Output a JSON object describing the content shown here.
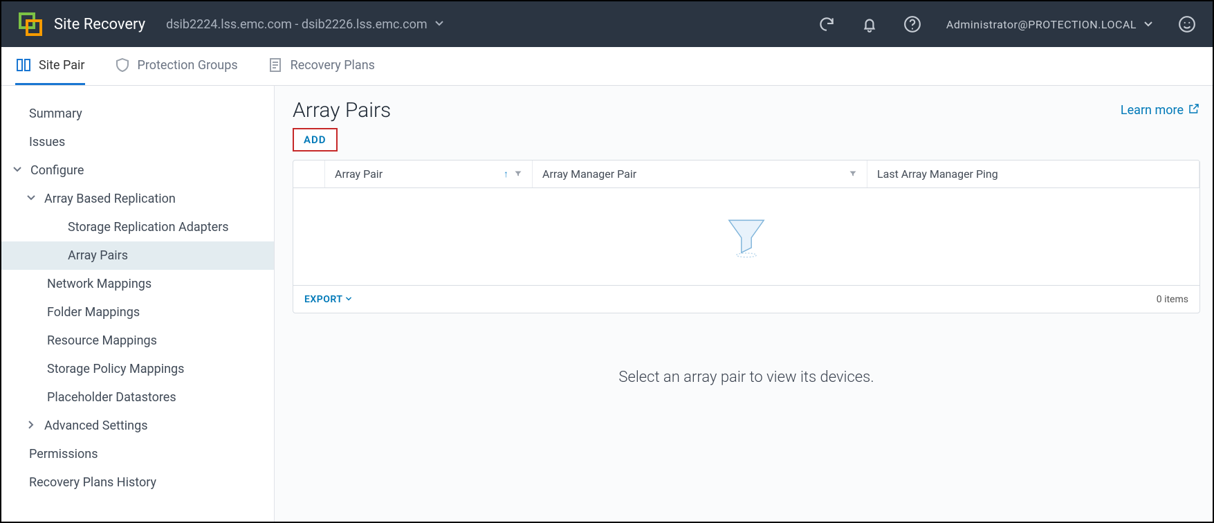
{
  "header": {
    "app_title": "Site Recovery",
    "site_pair": "dsib2224.lss.emc.com - dsib2226.lss.emc.com",
    "user": "Administrator@PROTECTION.LOCAL"
  },
  "tabs": {
    "site_pair": "Site Pair",
    "protection_groups": "Protection Groups",
    "recovery_plans": "Recovery Plans"
  },
  "sidebar": {
    "summary": "Summary",
    "issues": "Issues",
    "configure": "Configure",
    "abr": "Array Based Replication",
    "sra": "Storage Replication Adapters",
    "array_pairs": "Array Pairs",
    "network_mappings": "Network Mappings",
    "folder_mappings": "Folder Mappings",
    "resource_mappings": "Resource Mappings",
    "storage_policy_mappings": "Storage Policy Mappings",
    "placeholder_datastores": "Placeholder Datastores",
    "advanced_settings": "Advanced Settings",
    "permissions": "Permissions",
    "recovery_plans_history": "Recovery Plans History"
  },
  "main": {
    "title": "Array Pairs",
    "learn_more": "Learn more",
    "add_label": "ADD",
    "cols": {
      "array_pair": "Array Pair",
      "array_manager_pair": "Array Manager Pair",
      "last_ping": "Last Array Manager Ping"
    },
    "export": "EXPORT",
    "items_count": "0 items",
    "hint": "Select an array pair to view its devices."
  }
}
